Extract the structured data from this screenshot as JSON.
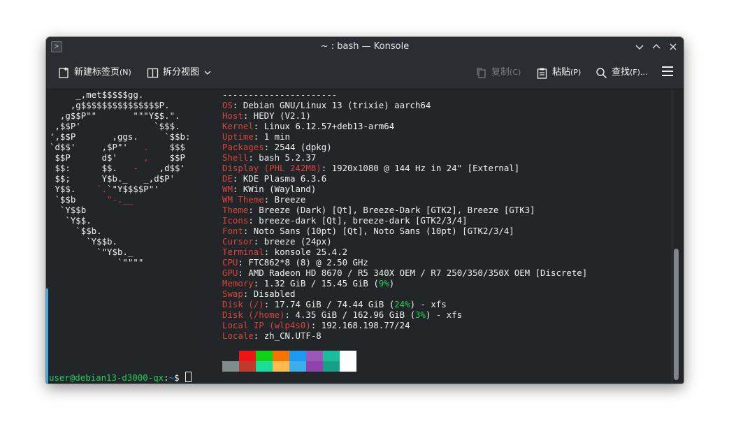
{
  "window": {
    "title": "~ : bash — Konsole",
    "app_icon": "terminal-icon",
    "controls": [
      "minimize-icon",
      "maximize-icon",
      "close-icon"
    ],
    "control_glyphs": {
      "minimize": "⌄",
      "maximize": "⌃",
      "close": "✕"
    }
  },
  "toolbar": {
    "new_tab_label": "新建标签页",
    "new_tab_shortcut": "(N)",
    "new_tab_icon": "new-tab-icon",
    "split_label": "拆分视图",
    "split_icon": "split-view-icon",
    "copy_label": "复制",
    "copy_shortcut": "(C)",
    "copy_icon": "copy-icon",
    "paste_label": "粘贴",
    "paste_shortcut": "(P)",
    "paste_icon": "paste-icon",
    "find_label": "查找",
    "find_shortcut": "(F)...",
    "find_icon": "search-icon",
    "menu_icon": "hamburger-menu-icon"
  },
  "logo_lines": [
    [
      [
        "w",
        "     _,met$$$$$gg."
      ]
    ],
    [
      [
        "w",
        "    ,g$$$$$$$$$$$$$$$P."
      ]
    ],
    [
      [
        "w",
        "  ,g$$P\"\"       \"\"\"Y$$.\"."
      ]
    ],
    [
      [
        "w",
        " ,$$P'              `$$$."
      ]
    ],
    [
      [
        "w",
        "',$$P       ,ggs.     `$$b:"
      ]
    ],
    [
      [
        "w",
        "`d$$'     ,$P\"'   "
      ],
      [
        "r",
        "."
      ],
      [
        "w",
        "    $$$"
      ]
    ],
    [
      [
        "w",
        " $$P      d$'     "
      ],
      [
        "r",
        ","
      ],
      [
        "w",
        "    $$P"
      ]
    ],
    [
      [
        "w",
        " $$:      $$.   "
      ],
      [
        "r",
        "-"
      ],
      [
        "w",
        "    ,d$$'"
      ]
    ],
    [
      [
        "w",
        " $$;      Y$b._   _,d$P'"
      ]
    ],
    [
      [
        "w",
        " Y$$.    "
      ],
      [
        "r",
        "`."
      ],
      [
        "w",
        "`\"Y$$$$P\"'"
      ]
    ],
    [
      [
        "w",
        " `$$b      "
      ],
      [
        "r",
        "\"-.__"
      ]
    ],
    [
      [
        "w",
        "  `Y$$b"
      ]
    ],
    [
      [
        "w",
        "   `Y$$."
      ]
    ],
    [
      [
        "w",
        "     `$$b."
      ]
    ],
    [
      [
        "w",
        "       `Y$$b."
      ]
    ],
    [
      [
        "w",
        "         `\"Y$b._"
      ]
    ],
    [
      [
        "w",
        "             `\"\"\"\""
      ]
    ]
  ],
  "info": {
    "user_host": "user@debian13-d3000-qx",
    "separator": "----------------------",
    "rows": [
      {
        "key": "OS",
        "value": "Debian GNU/Linux 13 (trixie) aarch64"
      },
      {
        "key": "Host",
        "value": "HEDY (V2.1)"
      },
      {
        "key": "Kernel",
        "value": "Linux 6.12.57+deb13-arm64"
      },
      {
        "key": "Uptime",
        "value": "1 min"
      },
      {
        "key": "Packages",
        "value": "2544 (dpkg)"
      },
      {
        "key": "Shell",
        "value": "bash 5.2.37"
      },
      {
        "key": "Display (PHL 242M8)",
        "value": "1920x1080 @ 144 Hz in 24\" [External]"
      },
      {
        "key": "DE",
        "value": "KDE Plasma 6.3.6"
      },
      {
        "key": "WM",
        "value": "KWin (Wayland)"
      },
      {
        "key": "WM Theme",
        "value": "Breeze"
      },
      {
        "key": "Theme",
        "value": "Breeze (Dark) [Qt], Breeze-Dark [GTK2], Breeze [GTK3]"
      },
      {
        "key": "Icons",
        "value": "breeze-dark [Qt], breeze-dark [GTK2/3/4]"
      },
      {
        "key": "Font",
        "value": "Noto Sans (10pt) [Qt], Noto Sans (10pt) [GTK2/3/4]"
      },
      {
        "key": "Cursor",
        "value": "breeze (24px)"
      },
      {
        "key": "Terminal",
        "value": "konsole 25.4.2"
      },
      {
        "key": "CPU",
        "value": "FTC862*8 (8) @ 2.50 GHz"
      },
      {
        "key": "GPU",
        "value": "AMD Radeon HD 8670 / R5 340X OEM / R7 250/350/350X OEM [Discrete]"
      },
      {
        "key": "Memory",
        "value": "1.32 GiB / 15.45 GiB (",
        "pct": "9%",
        "after": ")"
      },
      {
        "key": "Swap",
        "value": "Disabled"
      },
      {
        "key": "Disk (/)",
        "value": "17.74 GiB / 74.44 GiB (",
        "pct": "24%",
        "after": ") - xfs"
      },
      {
        "key": "Disk (/home)",
        "value": "4.35 GiB / 162.96 GiB (",
        "pct": "3%",
        "after": ") - xfs"
      },
      {
        "key": "Local IP (wlp4s0)",
        "value": "192.168.198.77/24"
      },
      {
        "key": "Locale",
        "value": "zh_CN.UTF-8"
      }
    ]
  },
  "palette": {
    "top": [
      "#232629",
      "#ed1515",
      "#11d116",
      "#f67400",
      "#1d99f3",
      "#9b59b6",
      "#1abc9c",
      "#fcfcfc"
    ],
    "bottom": [
      "#7f8c8d",
      "#c0392b",
      "#1cdc9a",
      "#fdbc4b",
      "#3daee9",
      "#8e44ad",
      "#16a085",
      "#ffffff"
    ]
  },
  "prompt": {
    "user": "user@debian13-d3000-qx",
    "sep": ":",
    "path": "~",
    "symbol": "$ "
  },
  "colors": {
    "key": "#d8443c",
    "percent": "#1cd15b",
    "text": "#eff0f1",
    "accent": "#3daee9",
    "logo_red": "#e0343a"
  }
}
